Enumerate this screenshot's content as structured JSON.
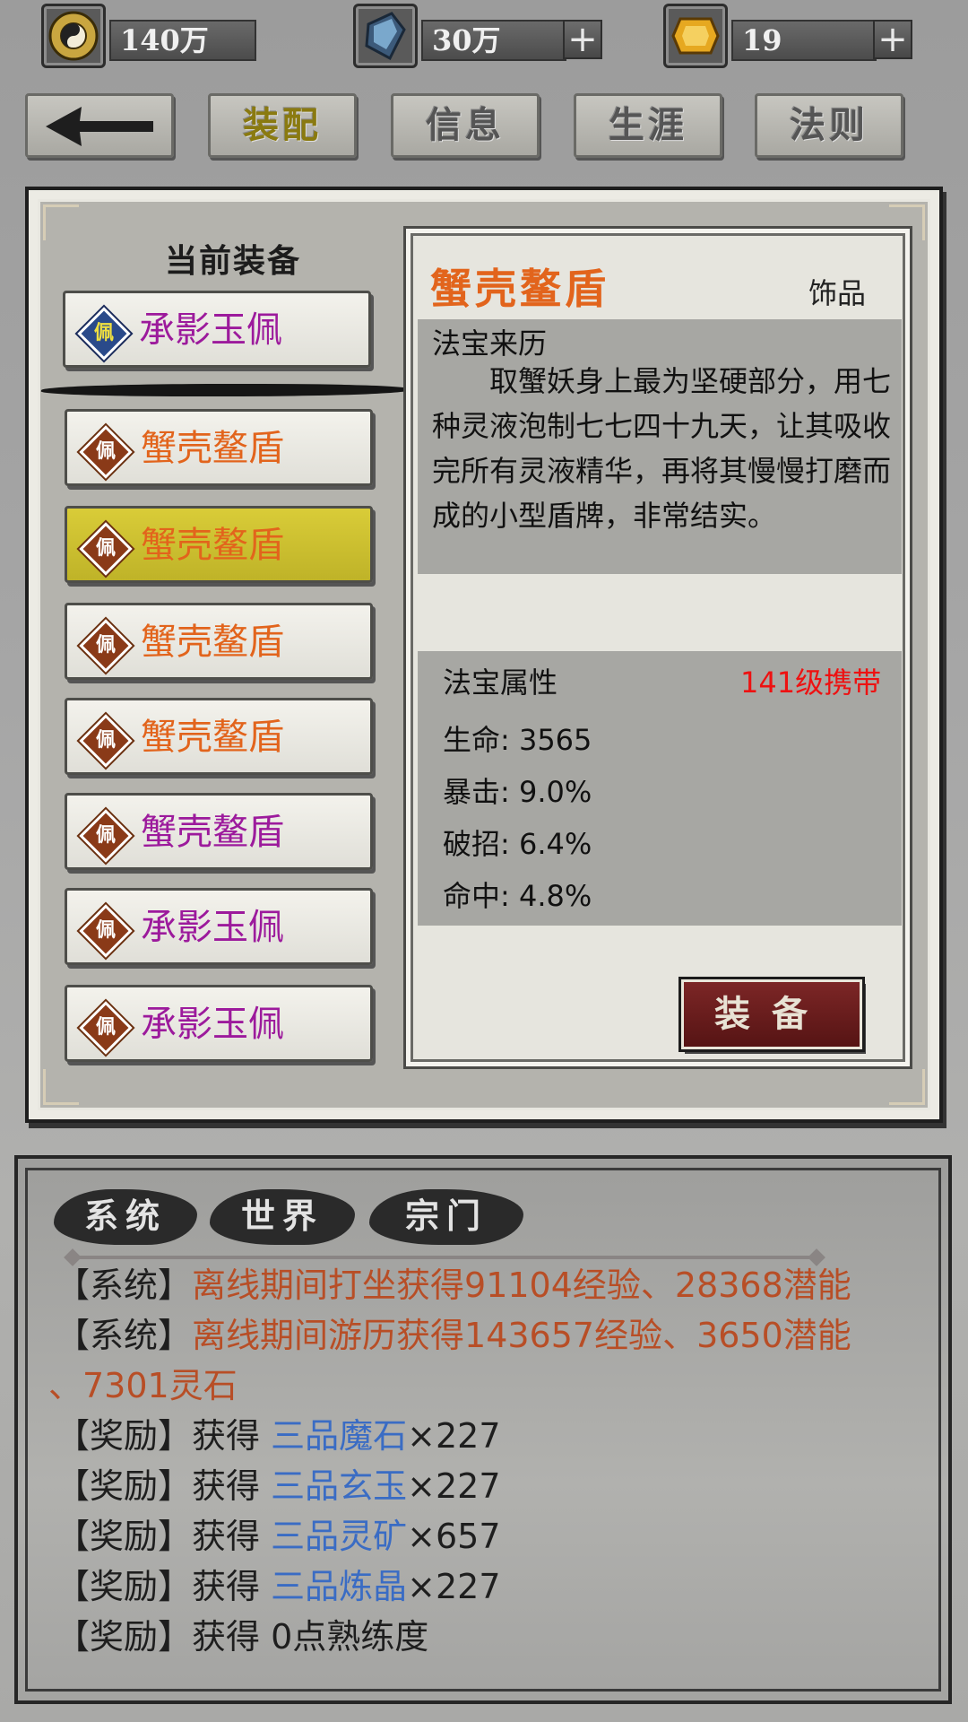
{
  "resources": {
    "coins": {
      "icon": "taiji-coin-icon",
      "value": "140万"
    },
    "crystal": {
      "icon": "blue-crystal-icon",
      "value": "30万"
    },
    "gem": {
      "icon": "gold-gem-icon",
      "value": "19"
    },
    "plus": "+"
  },
  "nav": {
    "back_icon": "back-arrow-icon",
    "tabs": [
      {
        "label": "装配",
        "active": true
      },
      {
        "label": "信息",
        "active": false
      },
      {
        "label": "生涯",
        "active": false
      },
      {
        "label": "法则",
        "active": false
      }
    ]
  },
  "equipment_list": {
    "title": "当前装备",
    "emblem_char": "佩",
    "current": {
      "name": "承影玉佩",
      "color": "#9c1a9c"
    },
    "items": [
      {
        "name": "蟹壳鳌盾",
        "color": "#e2641c",
        "selected": false
      },
      {
        "name": "蟹壳鳌盾",
        "color": "#e2641c",
        "selected": true
      },
      {
        "name": "蟹壳鳌盾",
        "color": "#e2641c",
        "selected": false
      },
      {
        "name": "蟹壳鳌盾",
        "color": "#e2641c",
        "selected": false
      },
      {
        "name": "蟹壳鳌盾",
        "color": "#9c1a9c",
        "selected": false
      },
      {
        "name": "承影玉佩",
        "color": "#9c1a9c",
        "selected": false
      },
      {
        "name": "承影玉佩",
        "color": "#9c1a9c",
        "selected": false
      }
    ]
  },
  "detail": {
    "title": "蟹壳鳌盾",
    "type": "饰品",
    "origin_label": "法宝来历",
    "origin_text": "取蟹妖身上最为坚硬部分，用七种灵液泡制七七四十九天，让其吸收完所有灵液精华，再将其慢慢打磨而成的小型盾牌，非常结实。",
    "attr_label": "法宝属性",
    "level_req": "141级携带",
    "attrs": [
      "生命: 3565",
      "暴击: 9.0%",
      "破招: 6.4%",
      "命中: 4.8%"
    ],
    "equip_button": "装备"
  },
  "chat": {
    "tabs": [
      "系统",
      "世界",
      "宗门"
    ],
    "lines": [
      {
        "tag": "【系统】",
        "text": "离线期间打坐获得91104经验、28368潜能"
      },
      {
        "tag": "【系统】",
        "text": "离线期间游历获得143657经验、3650潜能"
      },
      {
        "tag": "",
        "text": "、7301灵石"
      },
      {
        "tag": "【奖励】",
        "prefix": "获得 ",
        "item": "三品魔石",
        "suffix": "×227"
      },
      {
        "tag": "【奖励】",
        "prefix": "获得 ",
        "item": "三品玄玉",
        "suffix": "×227"
      },
      {
        "tag": "【奖励】",
        "prefix": "获得 ",
        "item": "三品灵矿",
        "suffix": "×657"
      },
      {
        "tag": "【奖励】",
        "prefix": "获得 ",
        "item": "三品炼晶",
        "suffix": "×227"
      },
      {
        "tag": "【奖励】",
        "prefix": "获得 0点熟练度",
        "item": "",
        "suffix": ""
      }
    ]
  }
}
